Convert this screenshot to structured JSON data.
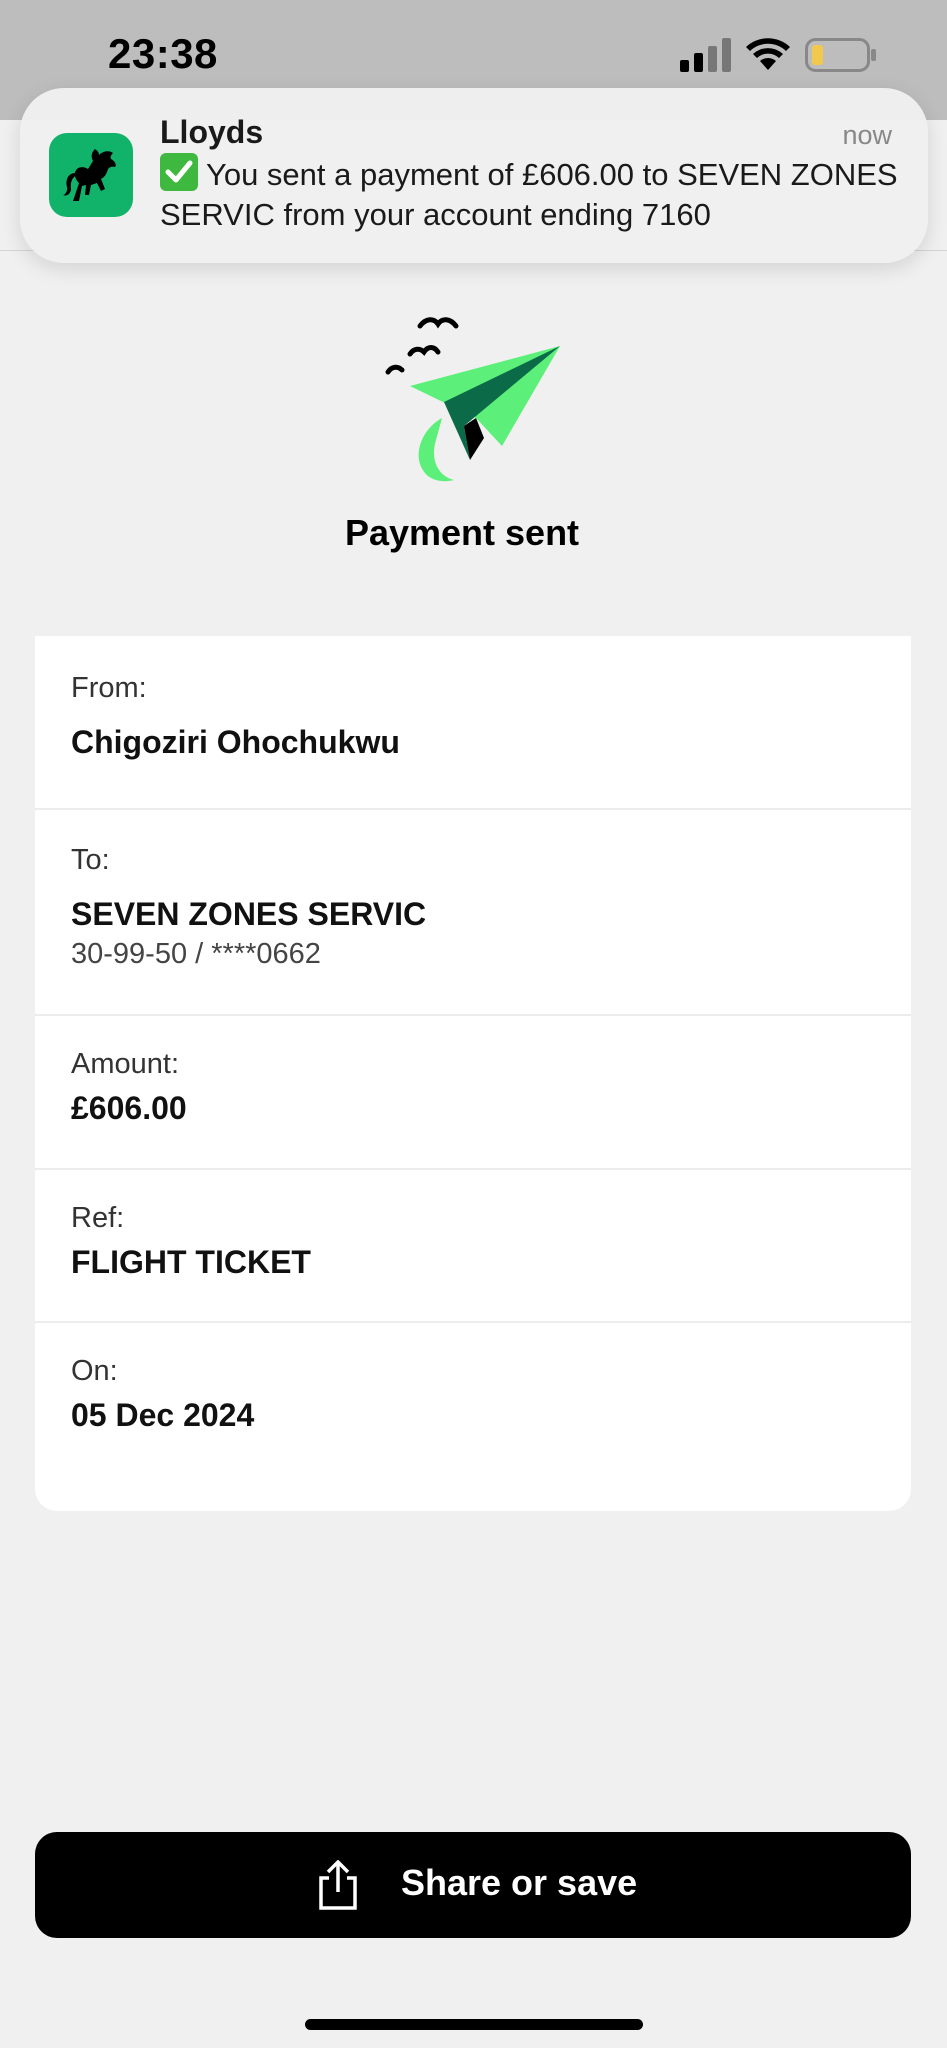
{
  "status_bar": {
    "time": "23:38",
    "signal_icon": "cellular-signal-icon",
    "wifi_icon": "wifi-icon",
    "battery_icon": "battery-low-icon"
  },
  "notification": {
    "app_name": "Lloyds",
    "time": "now",
    "message": "You sent a payment of £606.00 to SEVEN ZONES SERVIC from your account ending 7160",
    "icon": "lloyds-horse-icon",
    "check_icon": "check-mark-emoji-icon"
  },
  "page": {
    "title": "Payment sent",
    "illustration": "paper-plane-icon"
  },
  "details": {
    "from_label": "From:",
    "from_value": "Chigoziri Ohochukwu",
    "to_label": "To:",
    "to_value": "SEVEN ZONES SERVIC",
    "to_account": "30-99-50 / ****0662",
    "amount_label": "Amount:",
    "amount_value": "£606.00",
    "ref_label": "Ref:",
    "ref_value": "FLIGHT TICKET",
    "on_label": "On:",
    "on_value": "05 Dec 2024"
  },
  "actions": {
    "share_label": "Share or save",
    "share_icon": "share-icon"
  },
  "colors": {
    "lloyds_green": "#11b36b",
    "plane_light": "#5cf07a",
    "plane_dark": "#0b6b48",
    "button": "#000000"
  }
}
